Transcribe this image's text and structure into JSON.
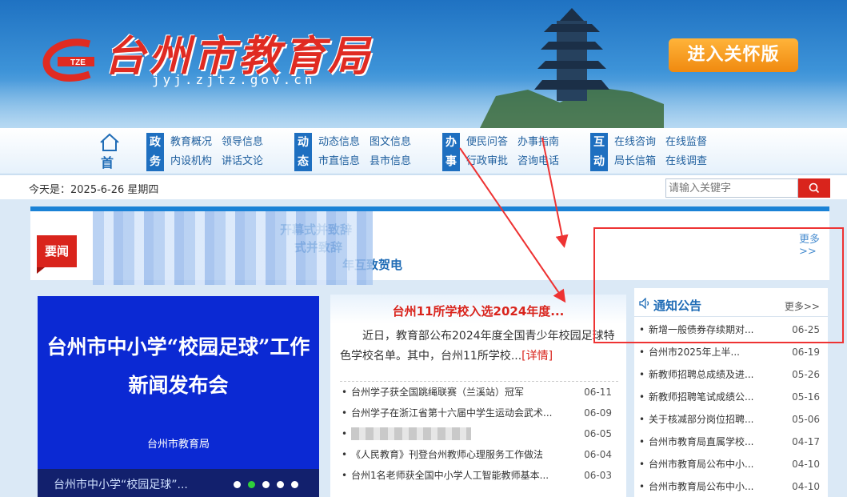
{
  "header": {
    "logo_text": "TZE",
    "title": "台州市教育局",
    "domain": "jyj.zjtz.gov.cn",
    "care_button": "进入关怀版"
  },
  "nav": {
    "home_label": "首 页",
    "groups": [
      {
        "tag": "政务",
        "links": [
          "教育概况",
          "领导信息",
          "内设机构",
          "讲话文论"
        ]
      },
      {
        "tag": "动态",
        "links": [
          "动态信息",
          "图文信息",
          "市直信息",
          "县市信息"
        ]
      },
      {
        "tag": "办事",
        "links": [
          "便民问答",
          "办事指南",
          "行政审批",
          "咨询电话"
        ]
      },
      {
        "tag": "互动",
        "links": [
          "在线咨询",
          "在线监督",
          "局长信箱",
          "在线调查"
        ]
      }
    ]
  },
  "date_row": {
    "date_text": "今天是：2025-6-26 星期四",
    "search_placeholder": "请输入关键字"
  },
  "top_news": {
    "badge": "要闻",
    "headlines": [
      "开幕式并致辞",
      "式并致辞",
      "年互致贺电"
    ],
    "more": "更多>>"
  },
  "slide": {
    "title_line1": "台州市中小学“校园足球”工作",
    "title_line2": "新闻发布会",
    "org": "台州市教育局",
    "caption": "台州市中小学“校园足球”..."
  },
  "featured": {
    "title": "台州11所学校入选2024年度...",
    "summary": "近日，教育部公布2024年度全国青少年校园足球特色学校名单。其中，台州11所学校...",
    "detail_link": "[详情]",
    "items": [
      {
        "title": "台州学子获全国跳绳联赛（兰溪站）冠军",
        "date": "06-11"
      },
      {
        "title": "台州学子在浙江省第十六届中学生运动会武术...",
        "date": "06-09"
      },
      {
        "title": "",
        "date": "06-05"
      },
      {
        "title": "《人民教育》刊登台州教师心理服务工作做法",
        "date": "06-04"
      },
      {
        "title": "台州1名老师获全国中小学人工智能教师基本...",
        "date": "06-03"
      }
    ]
  },
  "notices": {
    "title": "通知公告",
    "more": "更多>>",
    "items": [
      {
        "title": "新增一般债券存续期对...",
        "date": "06-25"
      },
      {
        "title": "台州市2025年上半...",
        "date": "06-19"
      },
      {
        "title": "新教师招聘总成绩及进...",
        "date": "05-26"
      },
      {
        "title": "新教师招聘笔试成绩公...",
        "date": "05-16"
      },
      {
        "title": "关于核减部分岗位招聘...",
        "date": "05-06"
      },
      {
        "title": "台州市教育局直属学校...",
        "date": "04-17"
      },
      {
        "title": "台州市教育局公布中小...",
        "date": "04-10"
      },
      {
        "title": "台州市教育局公布中小...",
        "date": "04-10"
      }
    ]
  },
  "colors": {
    "accent_red": "#d9241c",
    "nav_blue": "#1e6fc0",
    "slide_blue": "#0b29d3",
    "care_orange": "#f08a10"
  }
}
